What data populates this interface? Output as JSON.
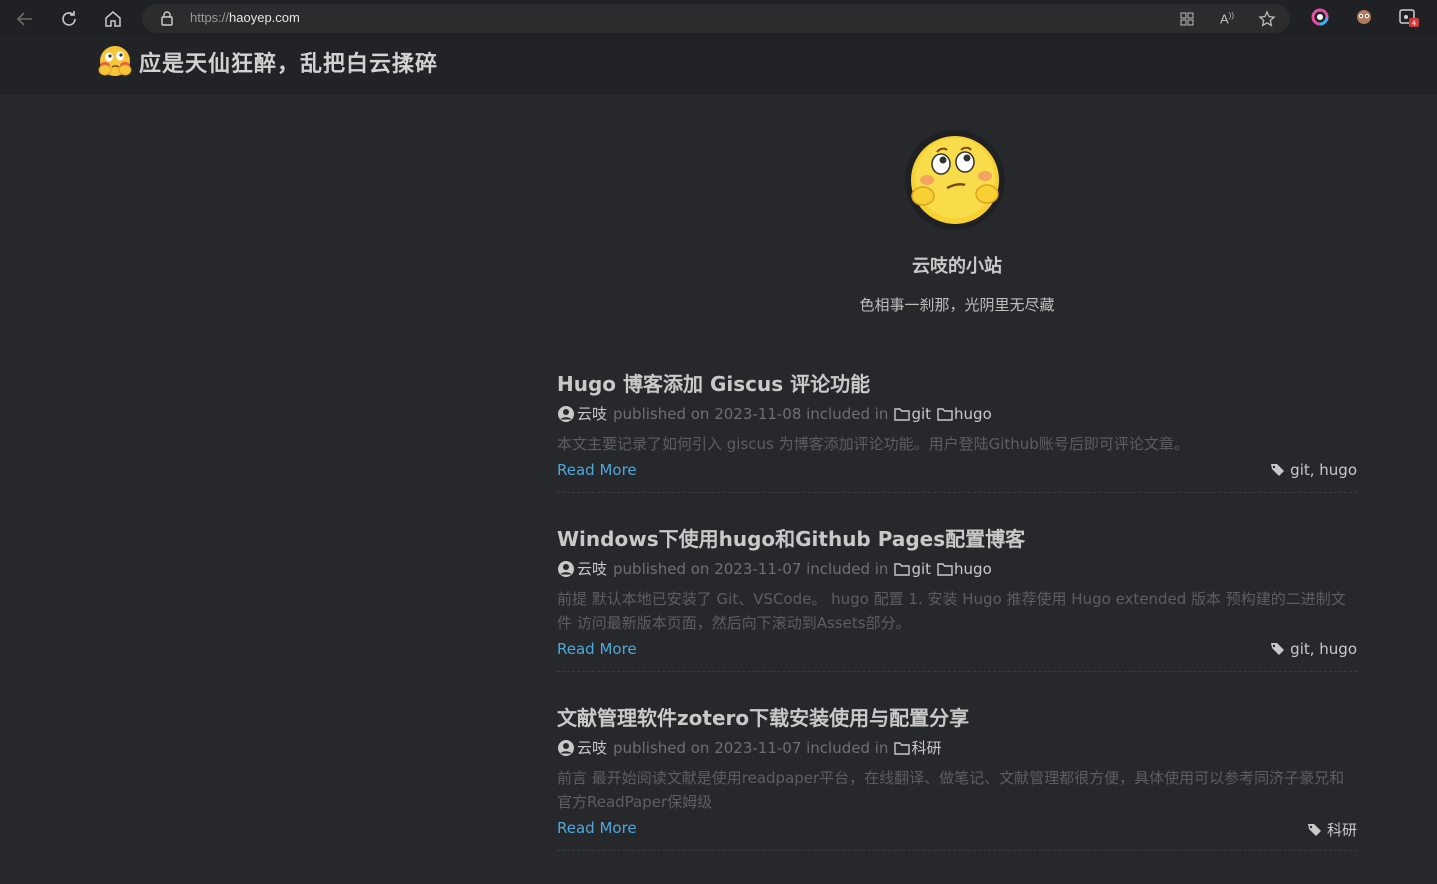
{
  "browser": {
    "url_scheme": "https://",
    "url_host": "haoyep.com"
  },
  "header": {
    "site_title": "应是天仙狂醉，乱把白云揉碎"
  },
  "profile": {
    "name": "云吱的小站",
    "motto": "色相事一刹那，光阴里无尽藏"
  },
  "posts": [
    {
      "title": "Hugo 博客添加 Giscus 评论功能",
      "author": "云吱",
      "meta_text": "published on 2023-11-08 included in",
      "categories": [
        "git",
        "hugo"
      ],
      "summary": "本文主要记录了如何引入 giscus 为博客添加评论功能。用户登陆Github账号后即可评论文章。",
      "read_more": "Read More",
      "tags": "git, hugo"
    },
    {
      "title": "Windows下使用hugo和Github Pages配置博客",
      "author": "云吱",
      "meta_text": "published on 2023-11-07 included in",
      "categories": [
        "git",
        "hugo"
      ],
      "summary": "前提 默认本地已安装了 Git、VSCode。 hugo 配置 1. 安装 Hugo 推荐使用 Hugo extended 版本 预构建的二进制文件 访问最新版本页面，然后向下滚动到Assets部分。",
      "read_more": "Read More",
      "tags": "git, hugo"
    },
    {
      "title": "文献管理软件zotero下载安装使用与配置分享",
      "author": "云吱",
      "meta_text": "published on 2023-11-07 included in",
      "categories": [
        "科研"
      ],
      "summary": "前言 最开始阅读文献是使用readpaper平台，在线翻译、做笔记、文献管理都很方便，具体使用可以参考同济子豪兄和官方ReadPaper保姆级",
      "read_more": "Read More",
      "tags": "科研"
    }
  ],
  "icons": {
    "back": "back-arrow-icon",
    "reload": "reload-icon",
    "home": "home-icon",
    "lock": "lock-icon",
    "apps": "apps-icon",
    "read_aloud": "read-aloud-icon",
    "favorite": "star-icon",
    "author": "user-circle-icon",
    "category": "folder-icon",
    "tag": "tag-icon"
  },
  "colors": {
    "page_bg": "#27282c",
    "link": "#4fa8d8",
    "title": "#c9c9c9"
  }
}
